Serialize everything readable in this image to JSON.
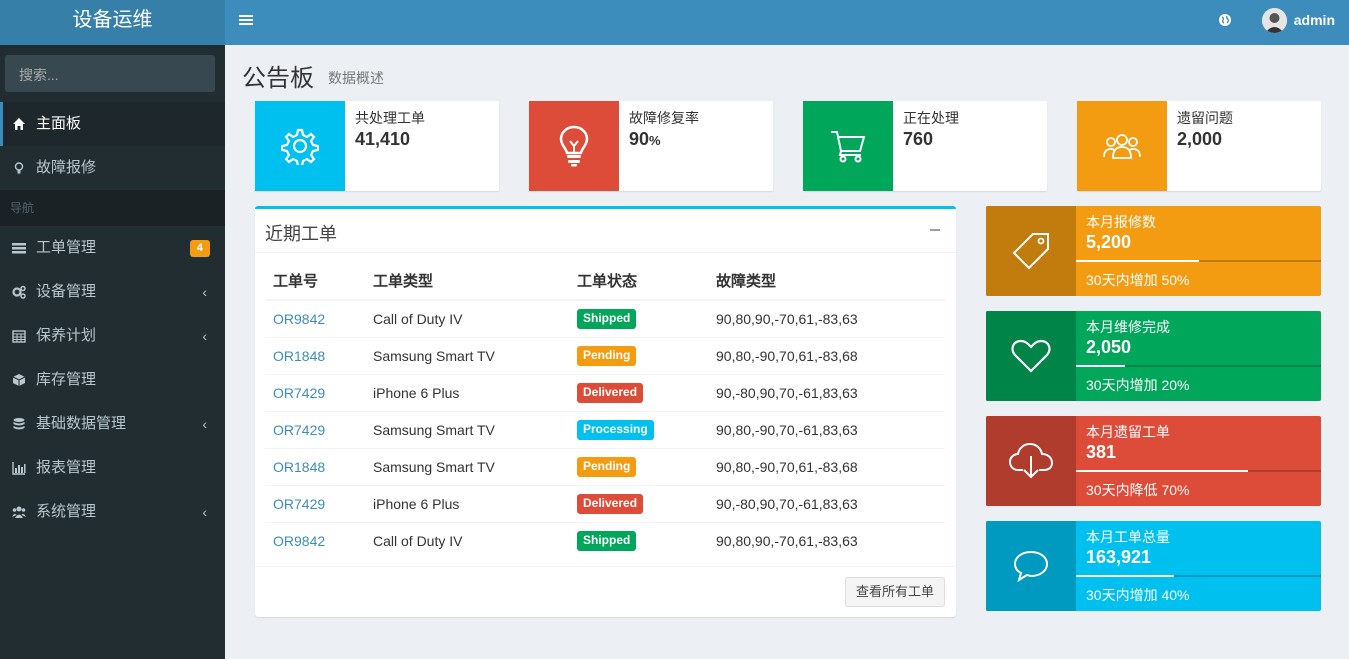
{
  "app": {
    "title": "设备运维"
  },
  "header": {
    "user_name": "admin"
  },
  "sidebar": {
    "search_placeholder": "搜索...",
    "items_top": [
      {
        "label": "主面板",
        "icon": "home-icon",
        "active": true
      },
      {
        "label": "故障报修",
        "icon": "lightbulb-icon"
      }
    ],
    "section_header": "导航",
    "items": [
      {
        "label": "工单管理",
        "icon": "list-icon",
        "badge": "4"
      },
      {
        "label": "设备管理",
        "icon": "gears-icon",
        "chevron": true
      },
      {
        "label": "保养计划",
        "icon": "calendar-icon",
        "chevron": true
      },
      {
        "label": "库存管理",
        "icon": "cube-icon"
      },
      {
        "label": "基础数据管理",
        "icon": "database-icon",
        "chevron": true
      },
      {
        "label": "报表管理",
        "icon": "bar-chart-icon"
      },
      {
        "label": "系统管理",
        "icon": "users-icon",
        "chevron": true
      }
    ]
  },
  "page": {
    "title": "公告板",
    "subtitle": "数据概述"
  },
  "info_boxes": [
    {
      "label": "共处理工单",
      "value": "41,410",
      "suffix": "",
      "color": "#00c0ef",
      "icon": "gear-icon"
    },
    {
      "label": "故障修复率",
      "value": "90",
      "suffix": "%",
      "color": "#dd4b39",
      "icon": "lightbulb-icon"
    },
    {
      "label": "正在处理",
      "value": "760",
      "suffix": "",
      "color": "#00a65a",
      "icon": "cart-icon"
    },
    {
      "label": "遗留问题",
      "value": "2,000",
      "suffix": "",
      "color": "#f39c12",
      "icon": "people-icon"
    }
  ],
  "orders_panel": {
    "title": "近期工单",
    "columns": [
      "工单号",
      "工单类型",
      "工单状态",
      "故障类型"
    ],
    "rows": [
      {
        "id": "OR9842",
        "type": "Call of Duty IV",
        "status": "Shipped",
        "status_color": "#00a65a",
        "fault": "90,80,90,-70,61,-83,63"
      },
      {
        "id": "OR1848",
        "type": "Samsung Smart TV",
        "status": "Pending",
        "status_color": "#f39c12",
        "fault": "90,80,-90,70,61,-83,68"
      },
      {
        "id": "OR7429",
        "type": "iPhone 6 Plus",
        "status": "Delivered",
        "status_color": "#dd4b39",
        "fault": "90,-80,90,70,-61,83,63"
      },
      {
        "id": "OR7429",
        "type": "Samsung Smart TV",
        "status": "Processing",
        "status_color": "#00c0ef",
        "fault": "90,80,-90,70,-61,83,63"
      },
      {
        "id": "OR1848",
        "type": "Samsung Smart TV",
        "status": "Pending",
        "status_color": "#f39c12",
        "fault": "90,80,-90,70,61,-83,68"
      },
      {
        "id": "OR7429",
        "type": "iPhone 6 Plus",
        "status": "Delivered",
        "status_color": "#dd4b39",
        "fault": "90,-80,90,70,-61,83,63"
      },
      {
        "id": "OR9842",
        "type": "Call of Duty IV",
        "status": "Shipped",
        "status_color": "#00a65a",
        "fault": "90,80,90,-70,61,-83,63"
      }
    ],
    "view_all_label": "查看所有工单"
  },
  "stat_boxes": [
    {
      "label": "本月报修数",
      "value": "5,200",
      "desc": "30天内增加 50%",
      "progress": 0.5,
      "color": "#f39c12",
      "icon": "tag-icon"
    },
    {
      "label": "本月维修完成",
      "value": "2,050",
      "desc": "30天内增加 20%",
      "progress": 0.2,
      "color": "#00a65a",
      "icon": "heart-icon"
    },
    {
      "label": "本月遗留工单",
      "value": "381",
      "desc": "30天内降低 70%",
      "progress": 0.7,
      "color": "#dd4b39",
      "icon": "cloud-download-icon"
    },
    {
      "label": "本月工单总量",
      "value": "163,921",
      "desc": "30天内增加 40%",
      "progress": 0.4,
      "color": "#00c0ef",
      "icon": "chat-icon"
    }
  ]
}
